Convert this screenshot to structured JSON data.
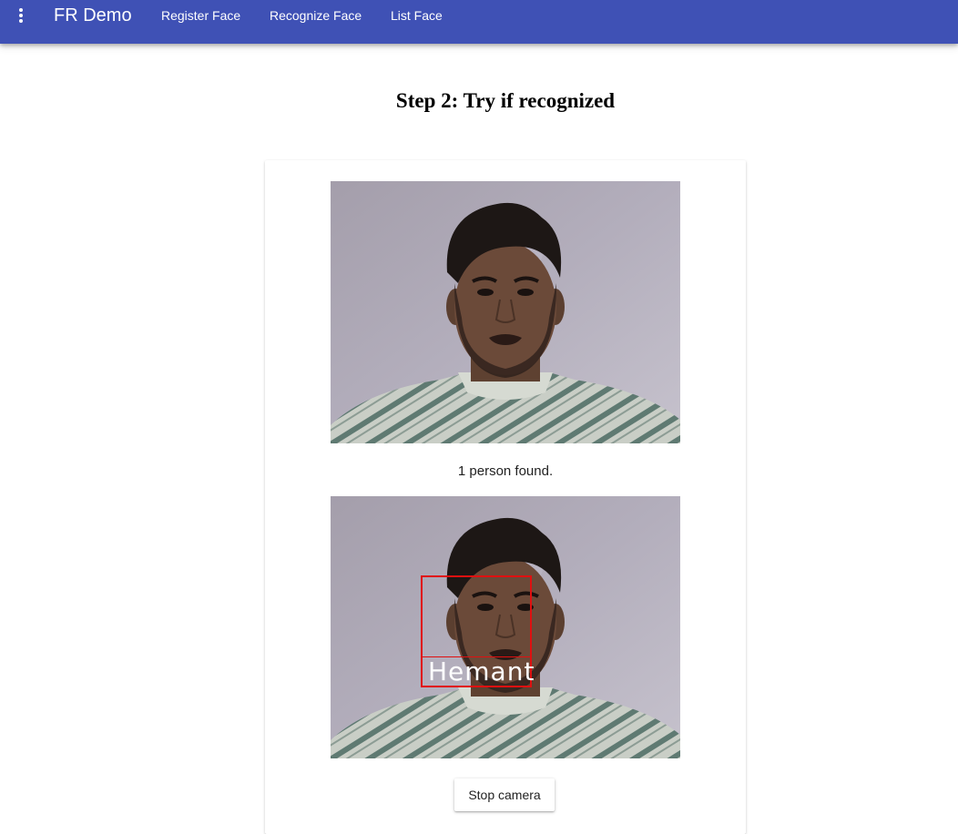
{
  "app": {
    "title": "FR Demo",
    "nav": [
      {
        "label": "Register Face"
      },
      {
        "label": "Recognize Face"
      },
      {
        "label": "List Face"
      }
    ]
  },
  "page": {
    "heading": "Step 2: Try if recognized"
  },
  "recognition": {
    "status": "1 person found.",
    "detected_name": "Hemant",
    "box_color": "#e01010"
  },
  "actions": {
    "stop_camera_label": "Stop camera"
  },
  "colors": {
    "toolbar": "#3f51b5",
    "background": "#ffffff",
    "wall": "#aca7b5",
    "shirt": "#c6ccc2",
    "skin": "#6a4a38",
    "hair": "#1d1715"
  },
  "icons": {
    "menu": "more-vertical-icon"
  }
}
